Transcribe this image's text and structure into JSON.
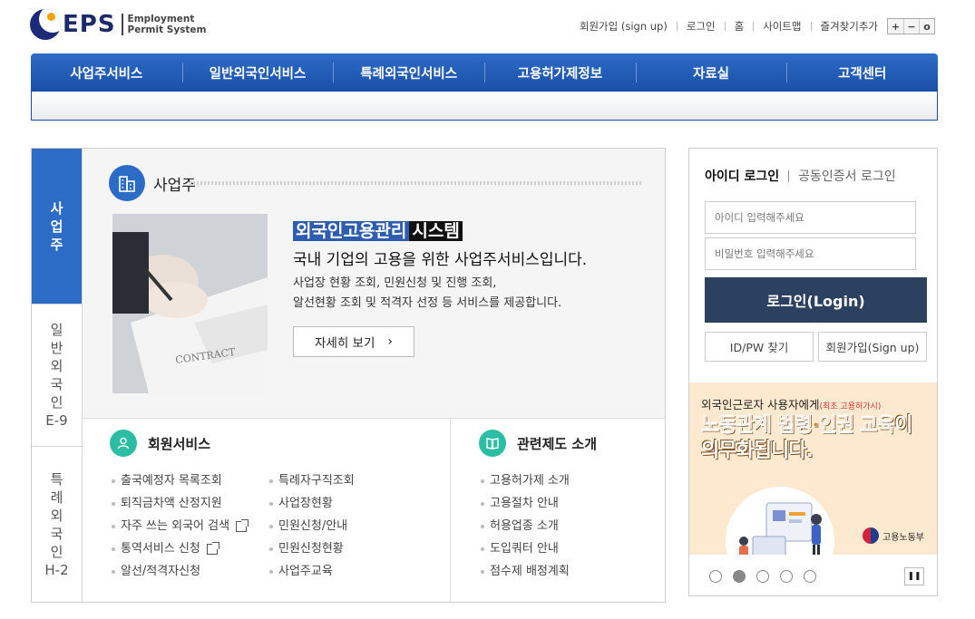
{
  "header": {
    "logo_text": "EPS",
    "logo_sub1": "Employment",
    "logo_sub2": "Permit System",
    "util": [
      "회원가입 (sign up)",
      "로그인",
      "홈",
      "사이트맵",
      "즐겨찾기추가"
    ],
    "zoom": [
      "+",
      "−",
      "o"
    ]
  },
  "nav": [
    "사업주서비스",
    "일반외국인서비스",
    "특례외국인서비스",
    "고용허가제정보",
    "자료실",
    "고객센터"
  ],
  "tabs": [
    {
      "label": "사업주",
      "active": true
    },
    {
      "label": "일반외국인",
      "sub": "E-9"
    },
    {
      "label": "특례외국인",
      "sub": "H-2"
    }
  ],
  "feature": {
    "section_title": "사업주",
    "headline_part1": "외국인고용관리",
    "headline_part2": "시스템",
    "subheadline": "국내 기업의 고용을 위한 사업주서비스입니다.",
    "desc_line1": "사업장 현황 조회, 민원신청 및 진행 조회,",
    "desc_line2": "알선현황 조회 및 적격자 선정 등 서비스를 제공합니다.",
    "more_label": "자세히 보기",
    "photo_text": "CONTRACT"
  },
  "member_service": {
    "title": "회원서비스",
    "col1": [
      "출국예정자 목록조회",
      "퇴직금차액 산정지원",
      "자주 쓰는 외국어 검색",
      "통역서비스 신청",
      "알선/적격자신청"
    ],
    "col2": [
      "특례자구직조회",
      "사업장현황",
      "민원신청/안내",
      "민원신청현황",
      "사업주교육"
    ]
  },
  "related": {
    "title": "관련제도 소개",
    "items": [
      "고용허가제 소개",
      "고용절차 안내",
      "허용업종 소개",
      "도입쿼터 안내",
      "점수제 배정계획"
    ]
  },
  "login": {
    "tab_id": "아이디 로그인",
    "tab_cert": "공동인증서 로그인",
    "id_placeholder": "아이디 입력해주세요",
    "pw_placeholder": "비밀번호 입력해주세요",
    "login_label": "로그인(Login)",
    "find_label": "ID/PW 찾기",
    "signup_label": "회원가입(Sign up)"
  },
  "banner": {
    "top": "외국인근로자 사용자에게",
    "top_small": "(최초 고용허가시)",
    "big1": "노동관계 법령·인권 교육",
    "big1_tail": "이",
    "big2": "의무화됩니다.",
    "ministry": "고용노동부",
    "slide_count": 5,
    "active_slide": 2
  },
  "colors": {
    "nav_blue": "#2d6cc6",
    "login_navy": "#2c4160",
    "teal": "#2bbea4",
    "banner_bg": "#fde9cf"
  }
}
